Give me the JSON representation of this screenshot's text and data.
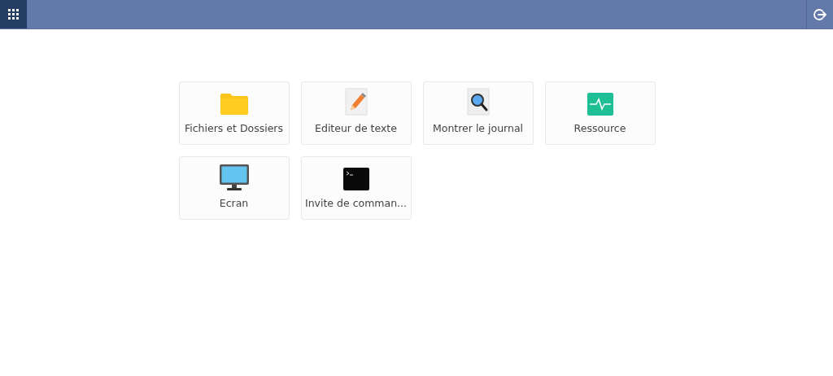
{
  "apps": [
    {
      "kind": "folder",
      "label": "Fichiers et Dossiers"
    },
    {
      "kind": "editor",
      "label": "Editeur de texte"
    },
    {
      "kind": "log",
      "label": "Montrer le journal"
    },
    {
      "kind": "resource",
      "label": "Ressource"
    },
    {
      "kind": "screen",
      "label": "Ecran"
    },
    {
      "kind": "terminal",
      "label": "Invite de comman..."
    }
  ]
}
